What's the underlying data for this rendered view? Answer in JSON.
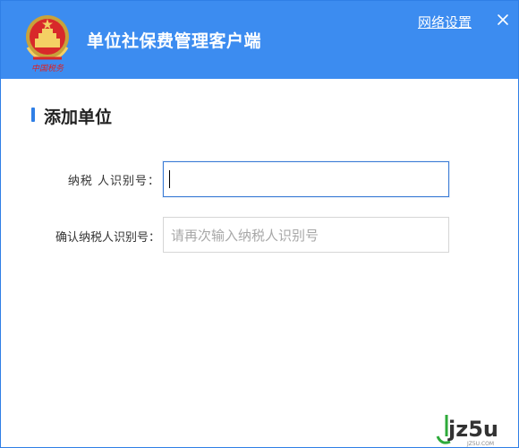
{
  "header": {
    "app_title": "单位社保费管理客户端",
    "network_settings_label": "网络设置",
    "logo_text": "中国税务",
    "close_glyph": "✕",
    "colors": {
      "header_bg": "#3c8cf0",
      "accent": "#2f7fe6"
    }
  },
  "main": {
    "section_title": "添加单位",
    "fields": [
      {
        "label": "纳税 人识别号：",
        "value": "",
        "placeholder": ""
      },
      {
        "label": "确认纳税人识别号：",
        "value": "",
        "placeholder": "请再次输入纳税人识别号"
      }
    ]
  },
  "watermark": {
    "text": "jz5u",
    "subtext": "JZ5U.COM"
  },
  "icons": [
    "tax-emblem-icon",
    "close-icon"
  ]
}
